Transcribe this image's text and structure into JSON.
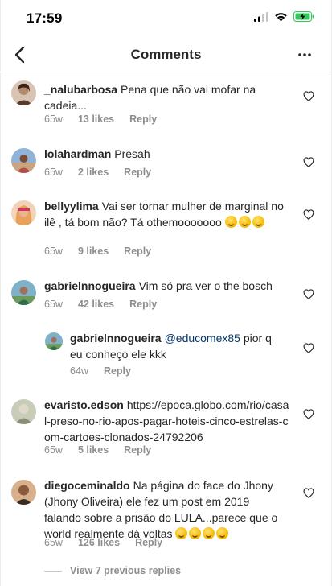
{
  "status": {
    "time": "17:59"
  },
  "nav": {
    "title": "Comments"
  },
  "comments": [
    {
      "user": "_nalubarbosa",
      "text": "Pena que não vai mofar na cadeia...",
      "time": "65w",
      "likes": "13 likes",
      "reply": "Reply",
      "avatar_color": "#b48a6d"
    },
    {
      "user": "lolahardman",
      "text": "Presah",
      "time": "65w",
      "likes": "2 likes",
      "reply": "Reply",
      "avatar_color": "#6f8fb8"
    },
    {
      "user": "bellyylima",
      "text": "Vai ser tornar mulher de marginal no ilê , tá bom não? Tá othemooooooo",
      "emoji_count": 3,
      "time": "65w",
      "likes": "9 likes",
      "reply": "Reply",
      "avatar_color": "#e0a27c"
    },
    {
      "user": "gabrielnnogueira",
      "text": "Vim só pra ver o the bosch",
      "time": "65w",
      "likes": "42 likes",
      "reply": "Reply",
      "avatar_color": "#5d8f6b"
    },
    {
      "user": "gabrielnnogueira",
      "mention": "@educomex85",
      "text": " pior q eu conheço ele kkk",
      "time": "64w",
      "reply": "Reply",
      "avatar_color": "#5d8f6b"
    },
    {
      "user": "evaristo.edson",
      "text": "https://epoca.globo.com/rio/casal-preso-no-rio-apos-pagar-hoteis-cinco-estrelas-com-cartoes-clonados-24792206",
      "time": "65w",
      "likes": "5 likes",
      "reply": "Reply",
      "avatar_color": "#9aa38a"
    },
    {
      "user": "diegoceminaldo",
      "text": "Na página do face do Jhony (Jhony Oliveira) ele fez um post em 2019 falando sobre a prisão do LULA...parece que o world realmente dá voltas",
      "emoji_count": 4,
      "time": "65w",
      "likes": "126 likes",
      "reply": "Reply",
      "avatar_color": "#8a5a3c"
    }
  ],
  "view_replies": "View 7 previous replies",
  "colors": {
    "text": "#262626",
    "meta": "#8e8e8e",
    "mention": "#00376b",
    "battery": "#34c759"
  }
}
